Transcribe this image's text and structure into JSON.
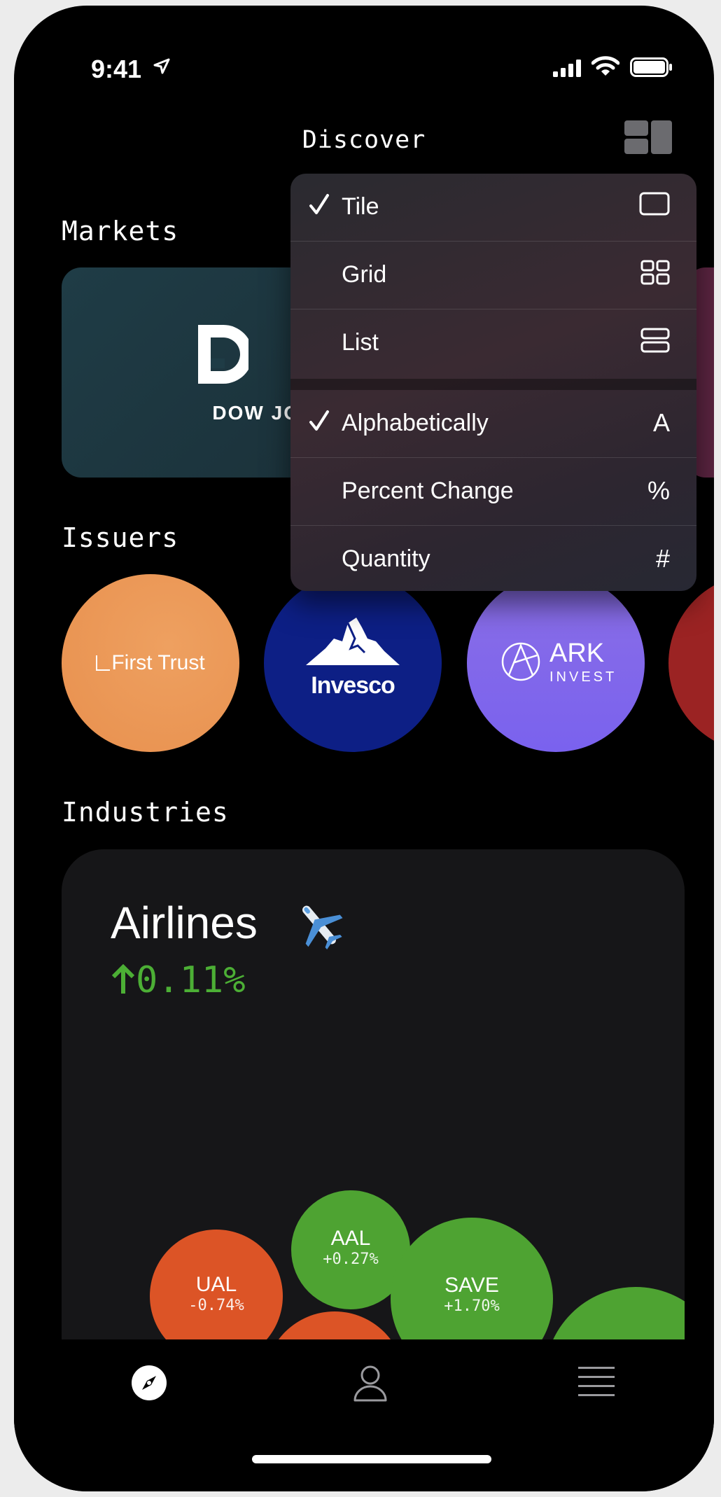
{
  "status_bar": {
    "time": "9:41"
  },
  "nav": {
    "title": "Discover"
  },
  "sections": {
    "markets": "Markets",
    "issuers": "Issuers",
    "industries": "Industries"
  },
  "markets": [
    {
      "name": "DOW JONES"
    }
  ],
  "issuers": [
    {
      "name": "First Trust",
      "color": "#e8904e"
    },
    {
      "name": "Invesco",
      "color": "#0d1f85"
    },
    {
      "name": "ARK",
      "sub": "INVEST",
      "color": "#7a62ee"
    }
  ],
  "industry": {
    "name": "Airlines",
    "emoji": "airplane-icon",
    "change": "0.11%",
    "stocks": [
      {
        "ticker": "UAL",
        "change": "-0.74%",
        "color": "#dc5426"
      },
      {
        "ticker": "AAL",
        "change": "+0.27%",
        "color": "#4ea332"
      },
      {
        "ticker": "SAVE",
        "change": "+1.70%",
        "color": "#4ea332"
      }
    ]
  },
  "menu": {
    "layout_items": [
      {
        "label": "Tile",
        "checked": true,
        "icon": "tile-icon"
      },
      {
        "label": "Grid",
        "checked": false,
        "icon": "grid-icon"
      },
      {
        "label": "List",
        "checked": false,
        "icon": "list-icon"
      }
    ],
    "sort_items": [
      {
        "label": "Alphabetically",
        "checked": true,
        "symbol": "A"
      },
      {
        "label": "Percent Change",
        "checked": false,
        "symbol": "%"
      },
      {
        "label": "Quantity",
        "checked": false,
        "symbol": "#"
      }
    ]
  },
  "tabs": [
    "discover-icon",
    "profile-icon",
    "menu-icon"
  ]
}
